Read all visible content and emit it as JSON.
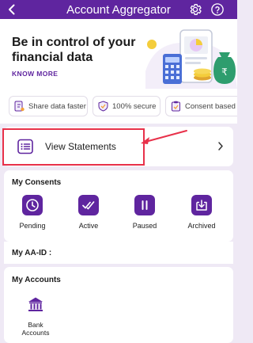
{
  "header": {
    "title": "Account Aggregator",
    "back_icon": "chevron-left-icon",
    "settings_icon": "gear-icon",
    "help_icon": "help-circle-icon",
    "color": "#5f259f"
  },
  "hero": {
    "title": "Be in control of your financial data",
    "link": "KNOW MORE",
    "illustration": "phone-calculator-moneybag-illustration"
  },
  "features": [
    {
      "label": "Share data faster",
      "icon": "document-share-icon"
    },
    {
      "label": "100% secure",
      "icon": "shield-check-icon"
    },
    {
      "label": "Consent based",
      "icon": "clipboard-check-icon"
    }
  ],
  "view_statements": {
    "label": "View Statements",
    "icon": "statement-list-icon"
  },
  "consents": {
    "title": "My Consents",
    "items": [
      {
        "label": "Pending",
        "icon": "clock-icon"
      },
      {
        "label": "Active",
        "icon": "double-check-icon"
      },
      {
        "label": "Paused",
        "icon": "pause-icon"
      },
      {
        "label": "Archived",
        "icon": "archive-icon"
      }
    ]
  },
  "aa_id": {
    "label": "My AA-ID :"
  },
  "accounts": {
    "title": "My Accounts",
    "items": [
      {
        "label": "Bank\nAccounts",
        "icon": "bank-icon"
      }
    ]
  },
  "colors": {
    "accent": "#5f259f",
    "annotation": "#e8314a",
    "background": "#efe9f5"
  }
}
